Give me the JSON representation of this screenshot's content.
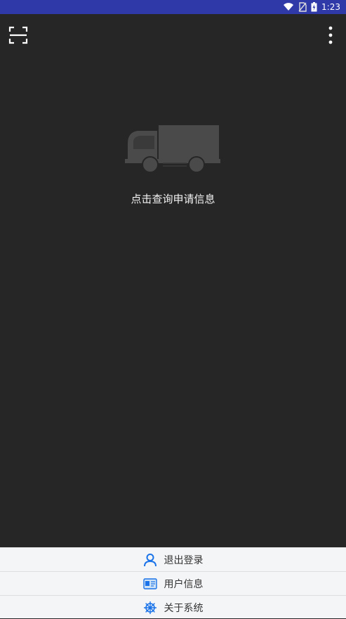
{
  "status_bar": {
    "time": "1:23",
    "icons": [
      "wifi-icon",
      "no-sim-icon",
      "battery-charging-icon"
    ]
  },
  "app_bar": {
    "left_icon": "scan-icon",
    "right_icon": "more-vert-icon"
  },
  "main": {
    "illustration": "truck-icon",
    "hint_text": "点击查询申请信息"
  },
  "bottom_menu": {
    "items": [
      {
        "label": "退出登录",
        "icon": "user-icon"
      },
      {
        "label": "用户信息",
        "icon": "id-card-icon"
      },
      {
        "label": "关于系统",
        "icon": "helm-icon"
      }
    ]
  },
  "colors": {
    "status_bar_bg": "#2f3aa8",
    "background": "#262626",
    "bottom_bg": "#f4f5f7",
    "icon_blue": "#1a73e8"
  }
}
